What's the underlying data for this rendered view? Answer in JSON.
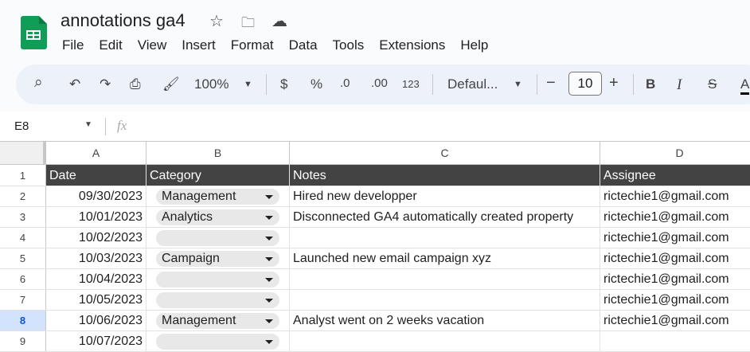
{
  "app": {
    "title": "annotations ga4",
    "icons": [
      "star-icon",
      "move-to-folder-icon",
      "cloud-saved-icon"
    ]
  },
  "menu": [
    "File",
    "Edit",
    "View",
    "Insert",
    "Format",
    "Data",
    "Tools",
    "Extensions",
    "Help"
  ],
  "toolbar": {
    "zoom": "100%",
    "currency": "$",
    "percent": "%",
    "decrease_decimal": ".0",
    "increase_decimal": ".00",
    "number_format": "123",
    "font": "Defaul...",
    "font_size": "10",
    "bold": "B",
    "italic": "I",
    "strike": "S",
    "text_color": "A"
  },
  "formula_bar": {
    "name_box": "E8",
    "fx": "fx",
    "value": ""
  },
  "columns": [
    "A",
    "B",
    "C",
    "D"
  ],
  "header": [
    "Date",
    "Category",
    "Notes",
    "Assignee"
  ],
  "rows": [
    {
      "n": "2",
      "date": "09/30/2023",
      "category": "Management",
      "notes": "Hired new developper",
      "assignee": "rictechie1@gmail.com"
    },
    {
      "n": "3",
      "date": "10/01/2023",
      "category": "Analytics",
      "notes": "Disconnected GA4 automatically created property",
      "assignee": "rictechie1@gmail.com"
    },
    {
      "n": "4",
      "date": "10/02/2023",
      "category": "",
      "notes": "",
      "assignee": "rictechie1@gmail.com"
    },
    {
      "n": "5",
      "date": "10/03/2023",
      "category": "Campaign",
      "notes": "Launched new email campaign xyz",
      "assignee": "rictechie1@gmail.com"
    },
    {
      "n": "6",
      "date": "10/04/2023",
      "category": "",
      "notes": "",
      "assignee": "rictechie1@gmail.com"
    },
    {
      "n": "7",
      "date": "10/05/2023",
      "category": "",
      "notes": "",
      "assignee": "rictechie1@gmail.com"
    },
    {
      "n": "8",
      "date": "10/06/2023",
      "category": "Management",
      "notes": "Analyst went on 2 weeks vacation",
      "assignee": "rictechie1@gmail.com"
    },
    {
      "n": "9",
      "date": "10/07/2023",
      "category": "",
      "notes": "",
      "assignee": ""
    }
  ],
  "selected_row": "8",
  "colors": {
    "header_bg": "#434343",
    "sheets_green": "#0f9d58",
    "toolbar_bg": "#edf2fa",
    "selected_row_header": "#d3e3fd"
  }
}
